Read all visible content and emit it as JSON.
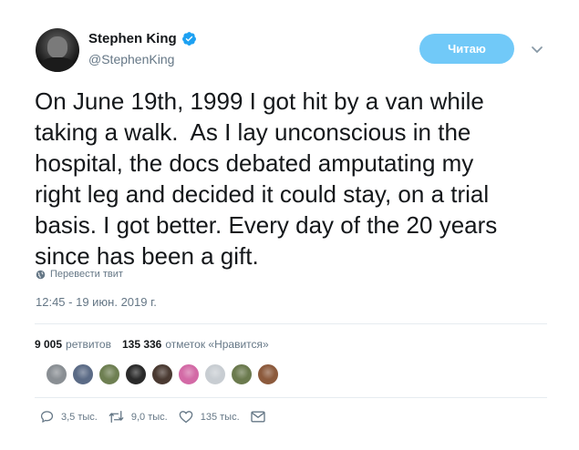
{
  "author": {
    "name": "Stephen King",
    "handle": "@StephenKing",
    "verified_icon": "verified-badge-icon"
  },
  "header": {
    "follow_label": "Читаю",
    "menu_icon": "chevron-down-icon"
  },
  "tweet": {
    "text": "On June 19th, 1999 I got hit by a van while\ntaking a walk.  As I lay unconscious in the\nhospital, the docs debated amputating my\nright leg and decided it could stay, on a trial\nbasis. I got better. Every day of the 20 years\nsince has been a gift.",
    "translate_label": "Перевести твит",
    "timestamp": "12:45 - 19 июн. 2019 г."
  },
  "stats": {
    "retweets_count": "9 005",
    "retweets_label": "ретвитов",
    "likes_count": "135 336",
    "likes_label": "отметок «Нравится»"
  },
  "likers": [
    {
      "color": "#8a8f94"
    },
    {
      "color": "#5b6b86"
    },
    {
      "color": "#6e7f52"
    },
    {
      "color": "#2a2a2a"
    },
    {
      "color": "#4a3a32"
    },
    {
      "color": "#d36aa6"
    },
    {
      "color": "#c8cdd2"
    },
    {
      "color": "#6b7a4e"
    },
    {
      "color": "#8c5a3c"
    }
  ],
  "actions": {
    "replies": "3,5 тыс.",
    "retweets": "9,0 тыс.",
    "likes": "135 тыс."
  },
  "colors": {
    "accent": "#1da1f2",
    "follow_button": "#71c9f8",
    "secondary_text": "#657786"
  }
}
